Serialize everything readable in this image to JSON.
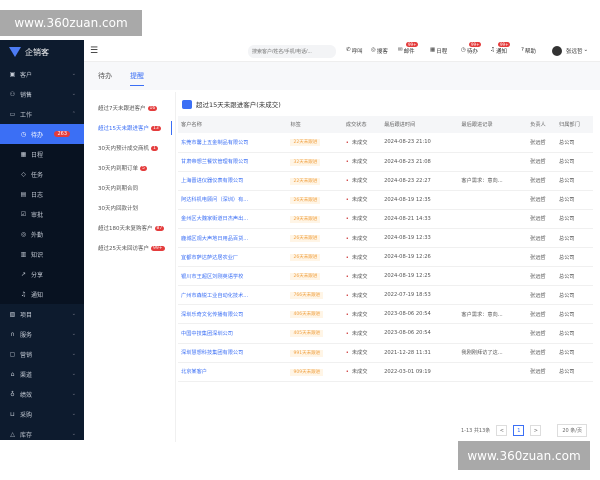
{
  "watermark": "www.360zuan.com",
  "app": {
    "name": "企销客"
  },
  "sidebar": {
    "items": [
      {
        "label": "客户",
        "icon": "customer-icon",
        "chevron": "⌄"
      },
      {
        "label": "销售",
        "icon": "person-icon",
        "chevron": "⌄"
      },
      {
        "label": "工作",
        "icon": "briefcase-icon",
        "chevron": "⌃"
      },
      {
        "label": "待办",
        "icon": "clock-icon",
        "badge": "263",
        "sub": true,
        "active": true
      },
      {
        "label": "日程",
        "icon": "calendar-icon",
        "sub": true
      },
      {
        "label": "任务",
        "icon": "tag-icon",
        "sub": true
      },
      {
        "label": "日志",
        "icon": "log-icon",
        "sub": true
      },
      {
        "label": "审批",
        "icon": "approval-icon",
        "sub": true
      },
      {
        "label": "外勤",
        "icon": "location-icon",
        "sub": true
      },
      {
        "label": "知识",
        "icon": "book-icon",
        "sub": true
      },
      {
        "label": "分享",
        "icon": "share-icon",
        "sub": true
      },
      {
        "label": "通知",
        "icon": "bell-icon",
        "sub": true
      },
      {
        "label": "项目",
        "icon": "project-icon",
        "chevron": "⌄"
      },
      {
        "label": "服务",
        "icon": "headset-icon",
        "chevron": "⌄"
      },
      {
        "label": "营销",
        "icon": "marketing-icon",
        "chevron": "⌄"
      },
      {
        "label": "渠道",
        "icon": "channel-icon",
        "chevron": "⌄"
      },
      {
        "label": "绩效",
        "icon": "trophy-icon",
        "chevron": "⌄"
      },
      {
        "label": "采购",
        "icon": "cart-icon",
        "chevron": "⌄"
      },
      {
        "label": "库存",
        "icon": "warehouse-icon",
        "chevron": "⌄"
      }
    ]
  },
  "header": {
    "search_placeholder": "搜索客户/姓名/手机/电话/...",
    "items": [
      {
        "label": "呼叫",
        "icon": "phone-icon"
      },
      {
        "label": "搜客",
        "icon": "search-customer-icon"
      },
      {
        "label": "邮件",
        "icon": "mail-icon",
        "badge": "99+"
      },
      {
        "label": "日程",
        "icon": "calendar-icon"
      },
      {
        "label": "待办",
        "icon": "clock-icon",
        "badge": "99+"
      },
      {
        "label": "通知",
        "icon": "bell-icon",
        "badge": "99+"
      },
      {
        "label": "帮助",
        "icon": "help-icon"
      }
    ],
    "user": "张远哲"
  },
  "tabs": [
    "待办",
    "提醒"
  ],
  "reminders": [
    {
      "label": "超过7天未跟进客户",
      "badge": "16"
    },
    {
      "label": "超过15天未跟进客户",
      "badge": "13",
      "active": true
    },
    {
      "label": "30天内预计成交商机",
      "badge": "1"
    },
    {
      "label": "30天内到期订单",
      "badge": "5"
    },
    {
      "label": "30天内到期合同"
    },
    {
      "label": "30天内回款计划"
    },
    {
      "label": "超过180天未复购客户",
      "badge": "87"
    },
    {
      "label": "超过25天未回访客户",
      "badge": "99+"
    }
  ],
  "panel": {
    "title": "超过15天未跟进客户(未成交)",
    "columns": [
      "客户名称",
      "标签",
      "成交状态",
      "最后跟进时间",
      "最后跟进记录",
      "负责人",
      "归属部门"
    ],
    "rows": [
      [
        "东莞市馨上五金制品有限公司",
        "22天未跟进",
        "未成交",
        "2024-08-23 21:10",
        "",
        "张远哲",
        "总公司"
      ],
      [
        "甘肃帝想兰餐饮管理有限公司",
        "32天未跟进",
        "未成交",
        "2024-08-23 21:08",
        "",
        "张远哲",
        "总公司"
      ],
      [
        "上海晋进仪器仪表有限公司",
        "22天未跟进",
        "未成交",
        "2024-08-23 22:27",
        "客户需求：意向...",
        "张远哲",
        "总公司"
      ],
      [
        "阿达科机电顾问（深圳）有...",
        "26天未跟进",
        "未成交",
        "2024-08-19 12:35",
        "",
        "张远哲",
        "总公司"
      ],
      [
        "金州区大魏家街道日杰声出...",
        "29天未跟进",
        "未成交",
        "2024-08-21 14:33",
        "",
        "张远哲",
        "总公司"
      ],
      [
        "鹿城区观大声地日用品百货...",
        "26天未跟进",
        "未成交",
        "2024-08-19 12:33",
        "",
        "张远哲",
        "总公司"
      ],
      [
        "宜都市萨达萨达居农业厂",
        "26天未跟进",
        "未成交",
        "2024-08-19 12:26",
        "",
        "张远哲",
        "总公司"
      ],
      [
        "银川市王超区刘刚英语学校",
        "26天未跟进",
        "未成交",
        "2024-08-19 12:25",
        "",
        "张远哲",
        "总公司"
      ],
      [
        "广州市森锐工业自动化技术...",
        "766天未跟进",
        "未成交",
        "2022-07-19 18:53",
        "",
        "张远哲",
        "总公司"
      ],
      [
        "深圳乐奇文化传播有限公司",
        "406天未跟进",
        "未成交",
        "2023-08-06 20:54",
        "客户需求：意向...",
        "张远哲",
        "总公司"
      ],
      [
        "中国中技集团深圳公司",
        "405天未跟进",
        "未成交",
        "2023-08-06 20:54",
        "",
        "张远哲",
        "总公司"
      ],
      [
        "深圳慧想科技集团有限公司",
        "991天未跟进",
        "未成交",
        "2021-12-28 11:31",
        "我刚刚拜访了这...",
        "张远哲",
        "总公司"
      ],
      [
        "北京某客户",
        "909天未跟进",
        "未成交",
        "2022-03-01 09:19",
        "",
        "张远哲",
        "总公司"
      ]
    ]
  },
  "pagination": {
    "summary": "1-13 共13条",
    "prev": "<",
    "page": "1",
    "next": ">",
    "page_size": "20 条/页"
  },
  "colors": {
    "accent": "#3b6ff5",
    "sidebar": "#0d1b2e",
    "badge": "#e43c3c"
  }
}
